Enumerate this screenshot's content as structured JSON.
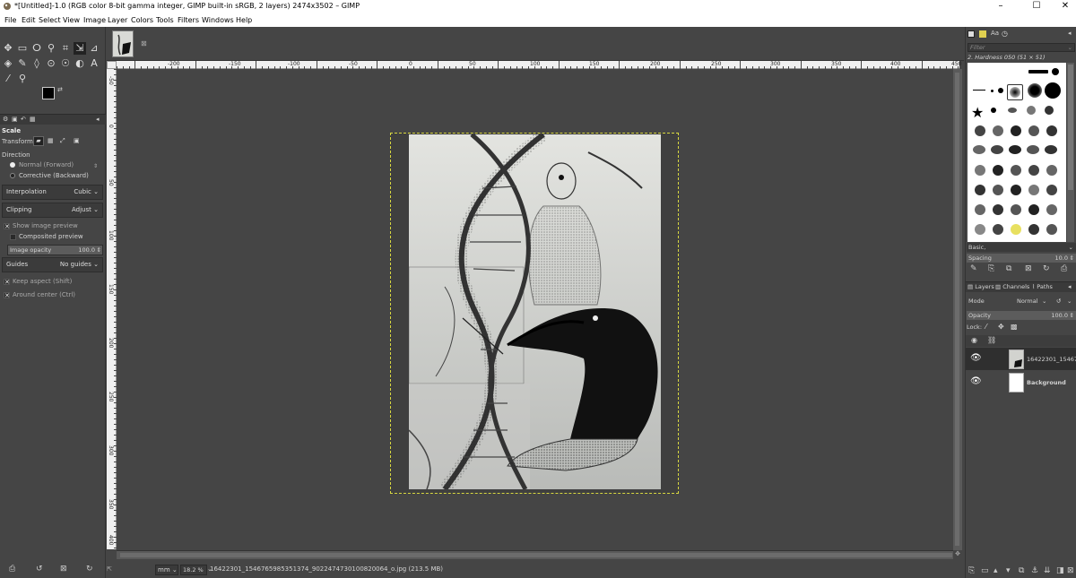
{
  "window": {
    "title": "*[Untitled]-1.0 (RGB color 8-bit gamma integer, GIMP built-in sRGB, 2 layers) 2474x3502 – GIMP",
    "minimize": "–",
    "maximize": "☐",
    "close": "✕"
  },
  "menu": [
    "File",
    "Edit",
    "Select",
    "View",
    "Image",
    "Layer",
    "Colors",
    "Tools",
    "Filters",
    "Windows",
    "Help"
  ],
  "tool_options": {
    "title": "Scale",
    "transform_label": "Transform:",
    "direction_label": "Direction",
    "direction_normal": "Normal (Forward)",
    "direction_corrective": "Corrective (Backward)",
    "interpolation_label": "Interpolation",
    "interpolation_value": "Cubic",
    "clipping_label": "Clipping",
    "clipping_value": "Adjust",
    "show_preview": "Show image preview",
    "composited_preview": "Composited preview",
    "image_opacity_label": "Image opacity",
    "image_opacity_value": "100.0",
    "guides_label": "Guides",
    "guides_value": "No guides",
    "keep_aspect": "Keep aspect (Shift)",
    "around_center": "Around center (Ctrl)"
  },
  "ruler": {
    "h_labels": [
      "-200",
      "-150",
      "-100",
      "-50",
      "0",
      "50",
      "100",
      "150",
      "200",
      "250",
      "300",
      "350",
      "400",
      "450"
    ],
    "v_labels": [
      "-50",
      "0",
      "50",
      "100",
      "150",
      "200",
      "250",
      "300",
      "350",
      "400"
    ]
  },
  "status": {
    "unit": "mm",
    "zoom": "18.2 %",
    "file_info": "16422301_1546765985351374_9022474730100820064_o.jpg (213.5 MB)"
  },
  "brushes": {
    "filter_placeholder": "Filter",
    "current_brush": "2. Hardness 050 (51 × 51)",
    "preset": "Basic,",
    "spacing_label": "Spacing",
    "spacing_value": "10.0"
  },
  "layers": {
    "tabs": [
      "Layers",
      "Channels",
      "Paths"
    ],
    "mode_label": "Mode",
    "mode_value": "Normal",
    "opacity_label": "Opacity",
    "opacity_value": "100.0",
    "lock_label": "Lock:",
    "items": [
      {
        "name": "16422301_154676"
      },
      {
        "name": "Background"
      }
    ]
  },
  "colors": {
    "accent_yellow": "#d8d840",
    "panel_bg": "#454545",
    "ruler_bg": "#f0f0f0"
  }
}
